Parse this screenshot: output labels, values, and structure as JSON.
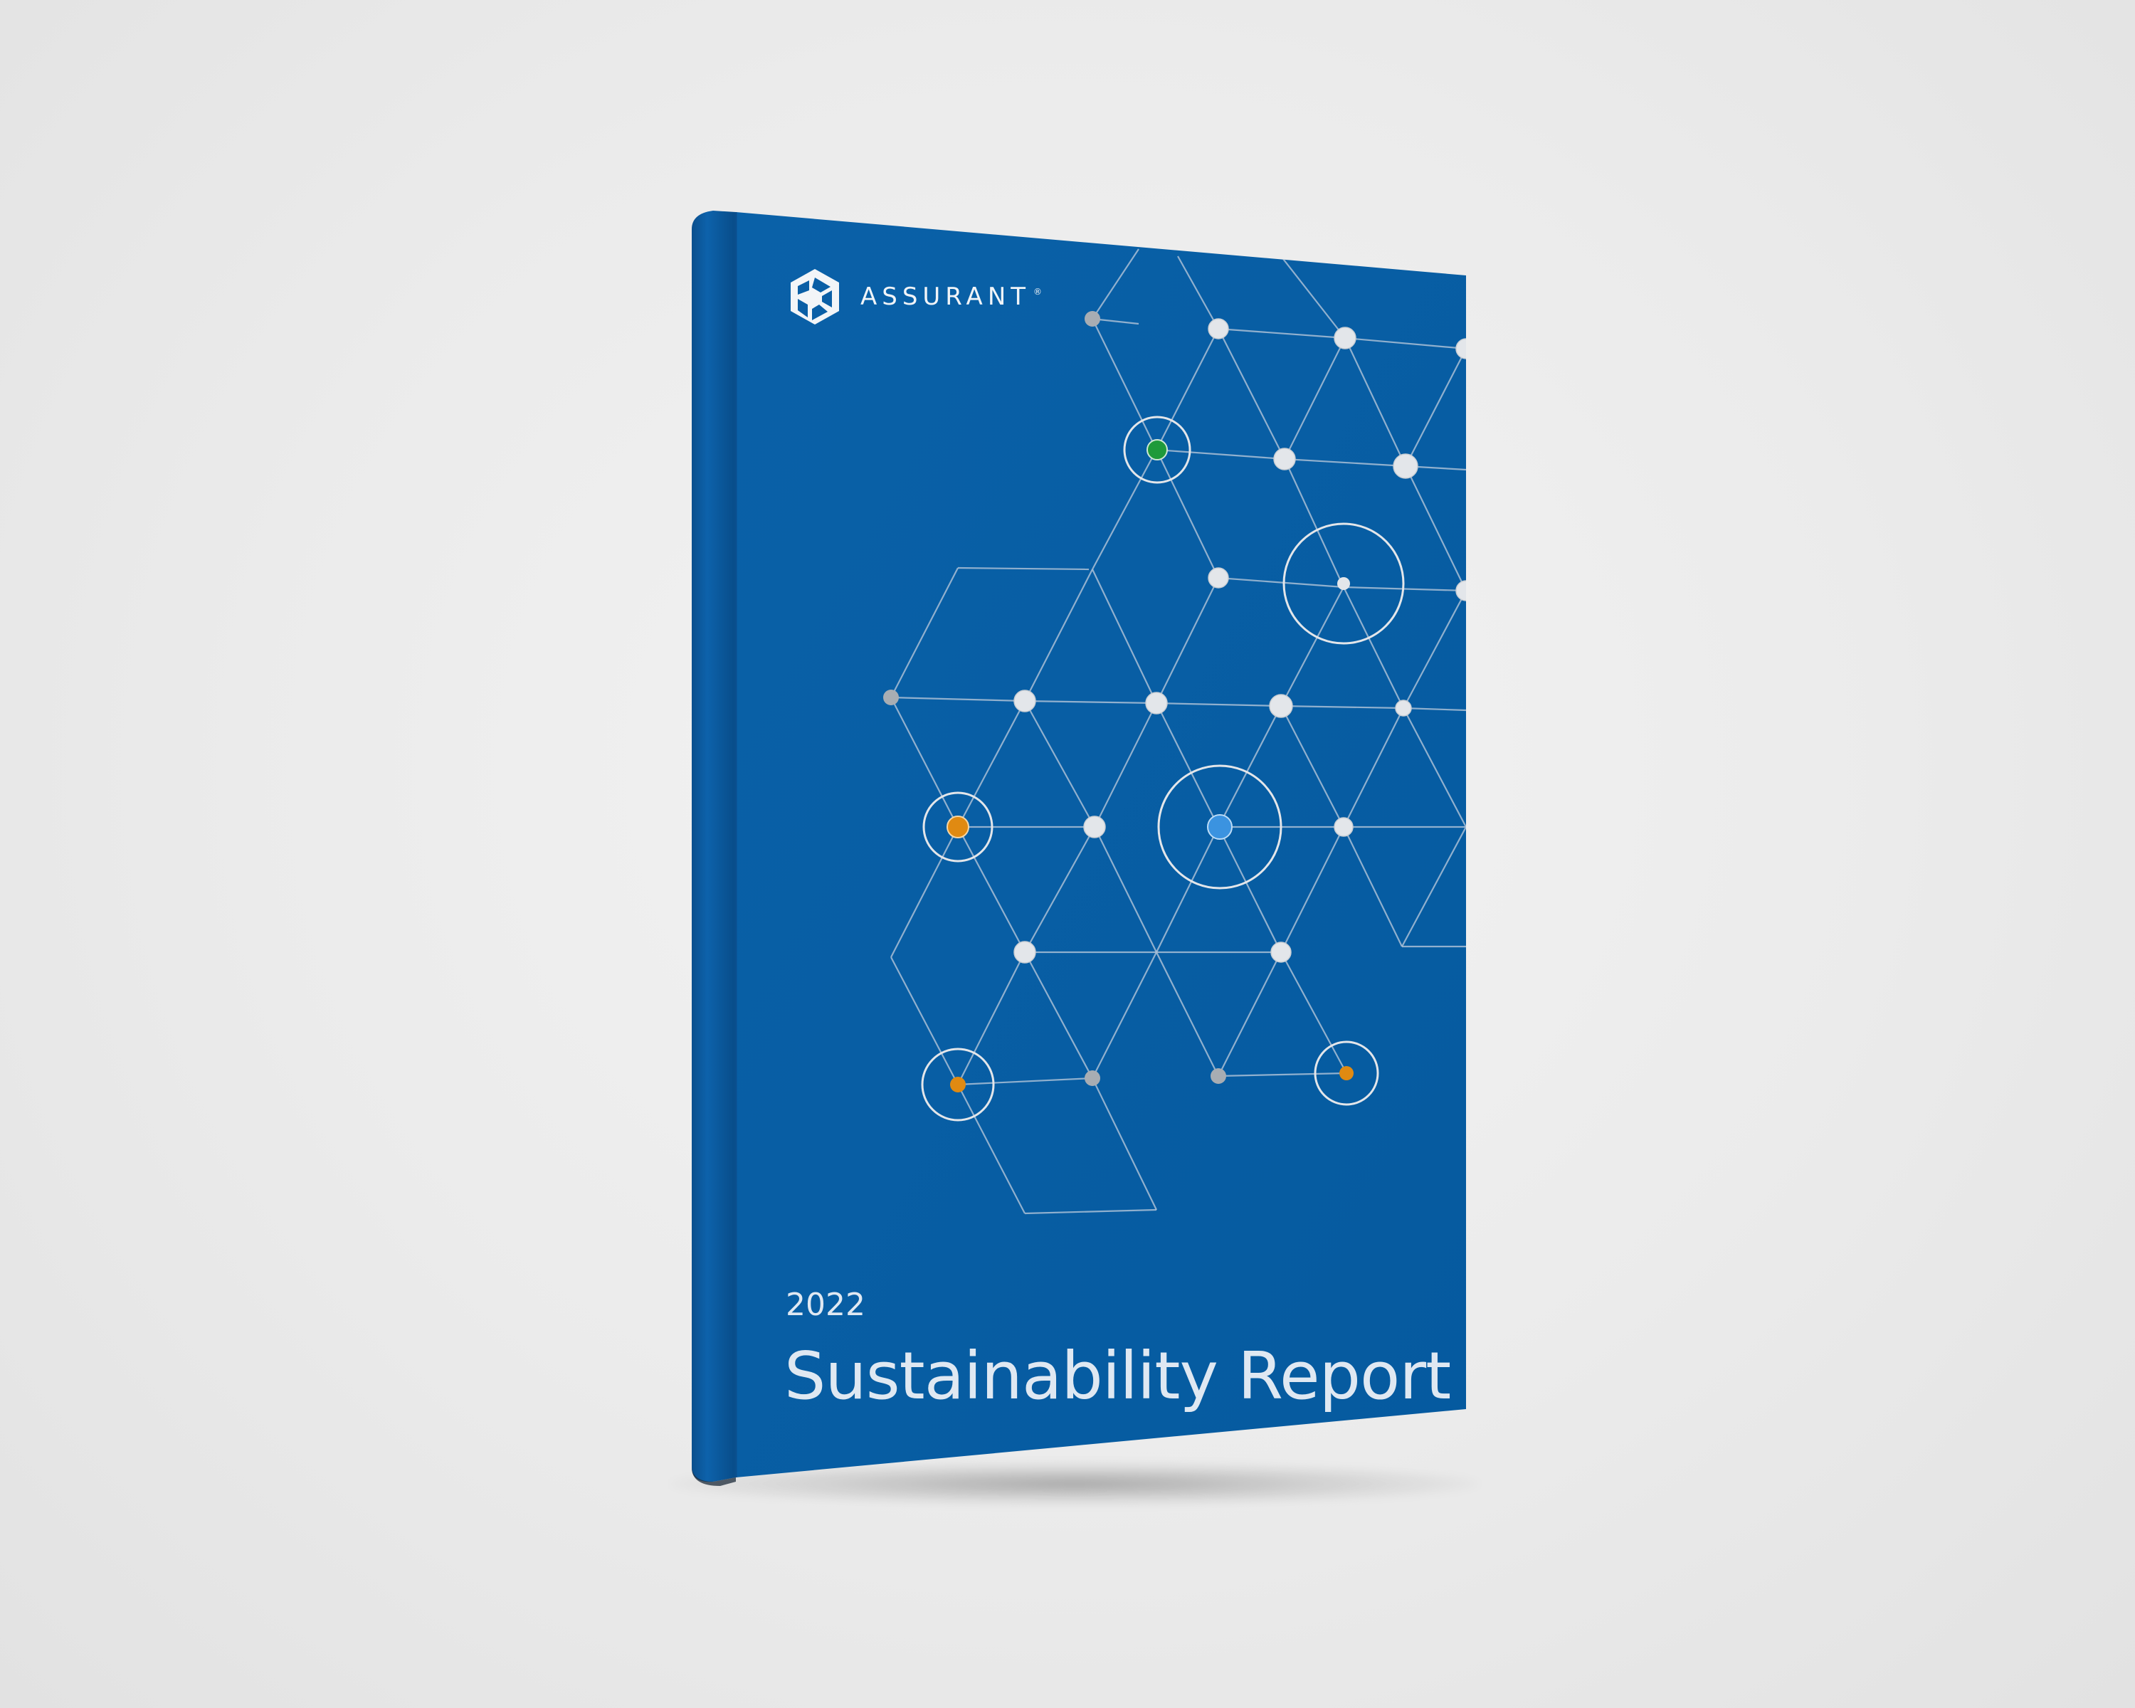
{
  "cover": {
    "brand_name": "ASSURANT",
    "brand_mark": "®",
    "year": "2022",
    "title": "Sustainability Report"
  },
  "colors": {
    "background": "#ececec",
    "cover_blue": "#075ea5",
    "spine_blue": "#0a5699",
    "line": "#a9bfd6",
    "node_light": "#e3e6ea",
    "node_gray": "#a8adb3",
    "accent_green": "#1f9a3a",
    "accent_orange": "#e08a12",
    "accent_blue": "#3b93e0"
  },
  "icons": {
    "logo": "assurant-logo-icon"
  }
}
